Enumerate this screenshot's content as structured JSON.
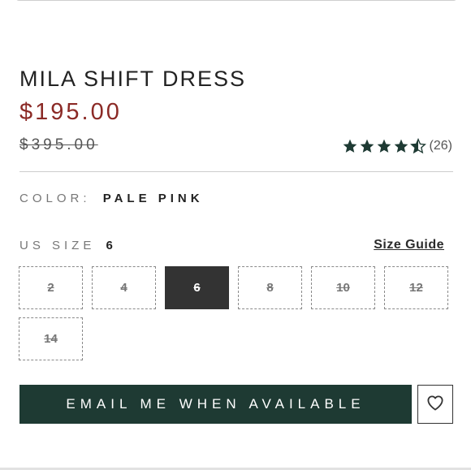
{
  "product": {
    "title": "MILA SHIFT DRESS",
    "price": "$195.00",
    "original_price": "$395.00"
  },
  "rating": {
    "stars_value": 4.5,
    "stars_max": 5,
    "count_text": "(26)",
    "star_color": "#1e3a33"
  },
  "color": {
    "label": "COLOR:",
    "value": "PALE PINK"
  },
  "size": {
    "label": "US SIZE",
    "selected": "6",
    "guide_label": "Size Guide",
    "options": [
      {
        "label": "2",
        "state": "unavailable"
      },
      {
        "label": "4",
        "state": "unavailable"
      },
      {
        "label": "6",
        "state": "selected"
      },
      {
        "label": "8",
        "state": "unavailable"
      },
      {
        "label": "10",
        "state": "unavailable"
      },
      {
        "label": "12",
        "state": "unavailable"
      },
      {
        "label": "14",
        "state": "unavailable"
      }
    ]
  },
  "cta": {
    "label": "EMAIL ME WHEN AVAILABLE",
    "color": "#1e3a33"
  },
  "wishlist": {
    "icon": "heart-icon"
  },
  "colors": {
    "price": "#8b2a26",
    "selected_size_bg": "#333333"
  }
}
